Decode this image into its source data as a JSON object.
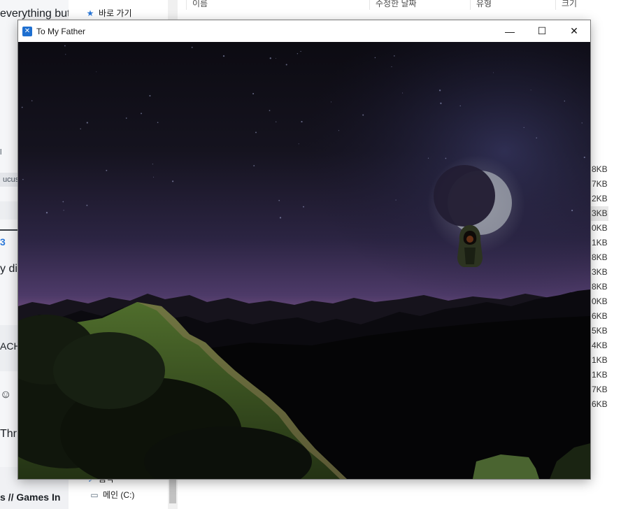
{
  "browser_fragments": {
    "line1": "everything but",
    "line2": "ucus",
    "line3": "y dig",
    "line4": "ACH",
    "line5": "Thr",
    "line6": "Games In",
    "line6_prefix": "s  //"
  },
  "explorer": {
    "nav_items": [
      {
        "label": "바로 가기",
        "icon": "star-icon"
      },
      {
        "label": "음악",
        "icon": "music-icon"
      },
      {
        "label": "메인 (C:)",
        "icon": "drive-icon"
      }
    ],
    "columns": [
      "이름",
      "수정한 날짜",
      "유형",
      "크기"
    ],
    "sizes": [
      "8KB",
      "7KB",
      "2KB",
      "3KB",
      "0KB",
      "1KB",
      "8KB",
      "3KB",
      "8KB",
      "0KB",
      "6KB",
      "5KB",
      "4KB",
      "1KB",
      "1KB",
      "7KB",
      "6KB"
    ]
  },
  "game_window": {
    "title": "To My Father",
    "minimize_symbol": "—",
    "maximize_symbol": "☐",
    "close_symbol": "✕"
  },
  "scene": {
    "sky_top": "#0d0c16",
    "sky_mid": "#2a2340",
    "horizon_glow": "#8e5f8e",
    "mountain_color": "#0a0a0e",
    "grass_color": "#3d5a25",
    "moon_color": "#aab0b8"
  }
}
